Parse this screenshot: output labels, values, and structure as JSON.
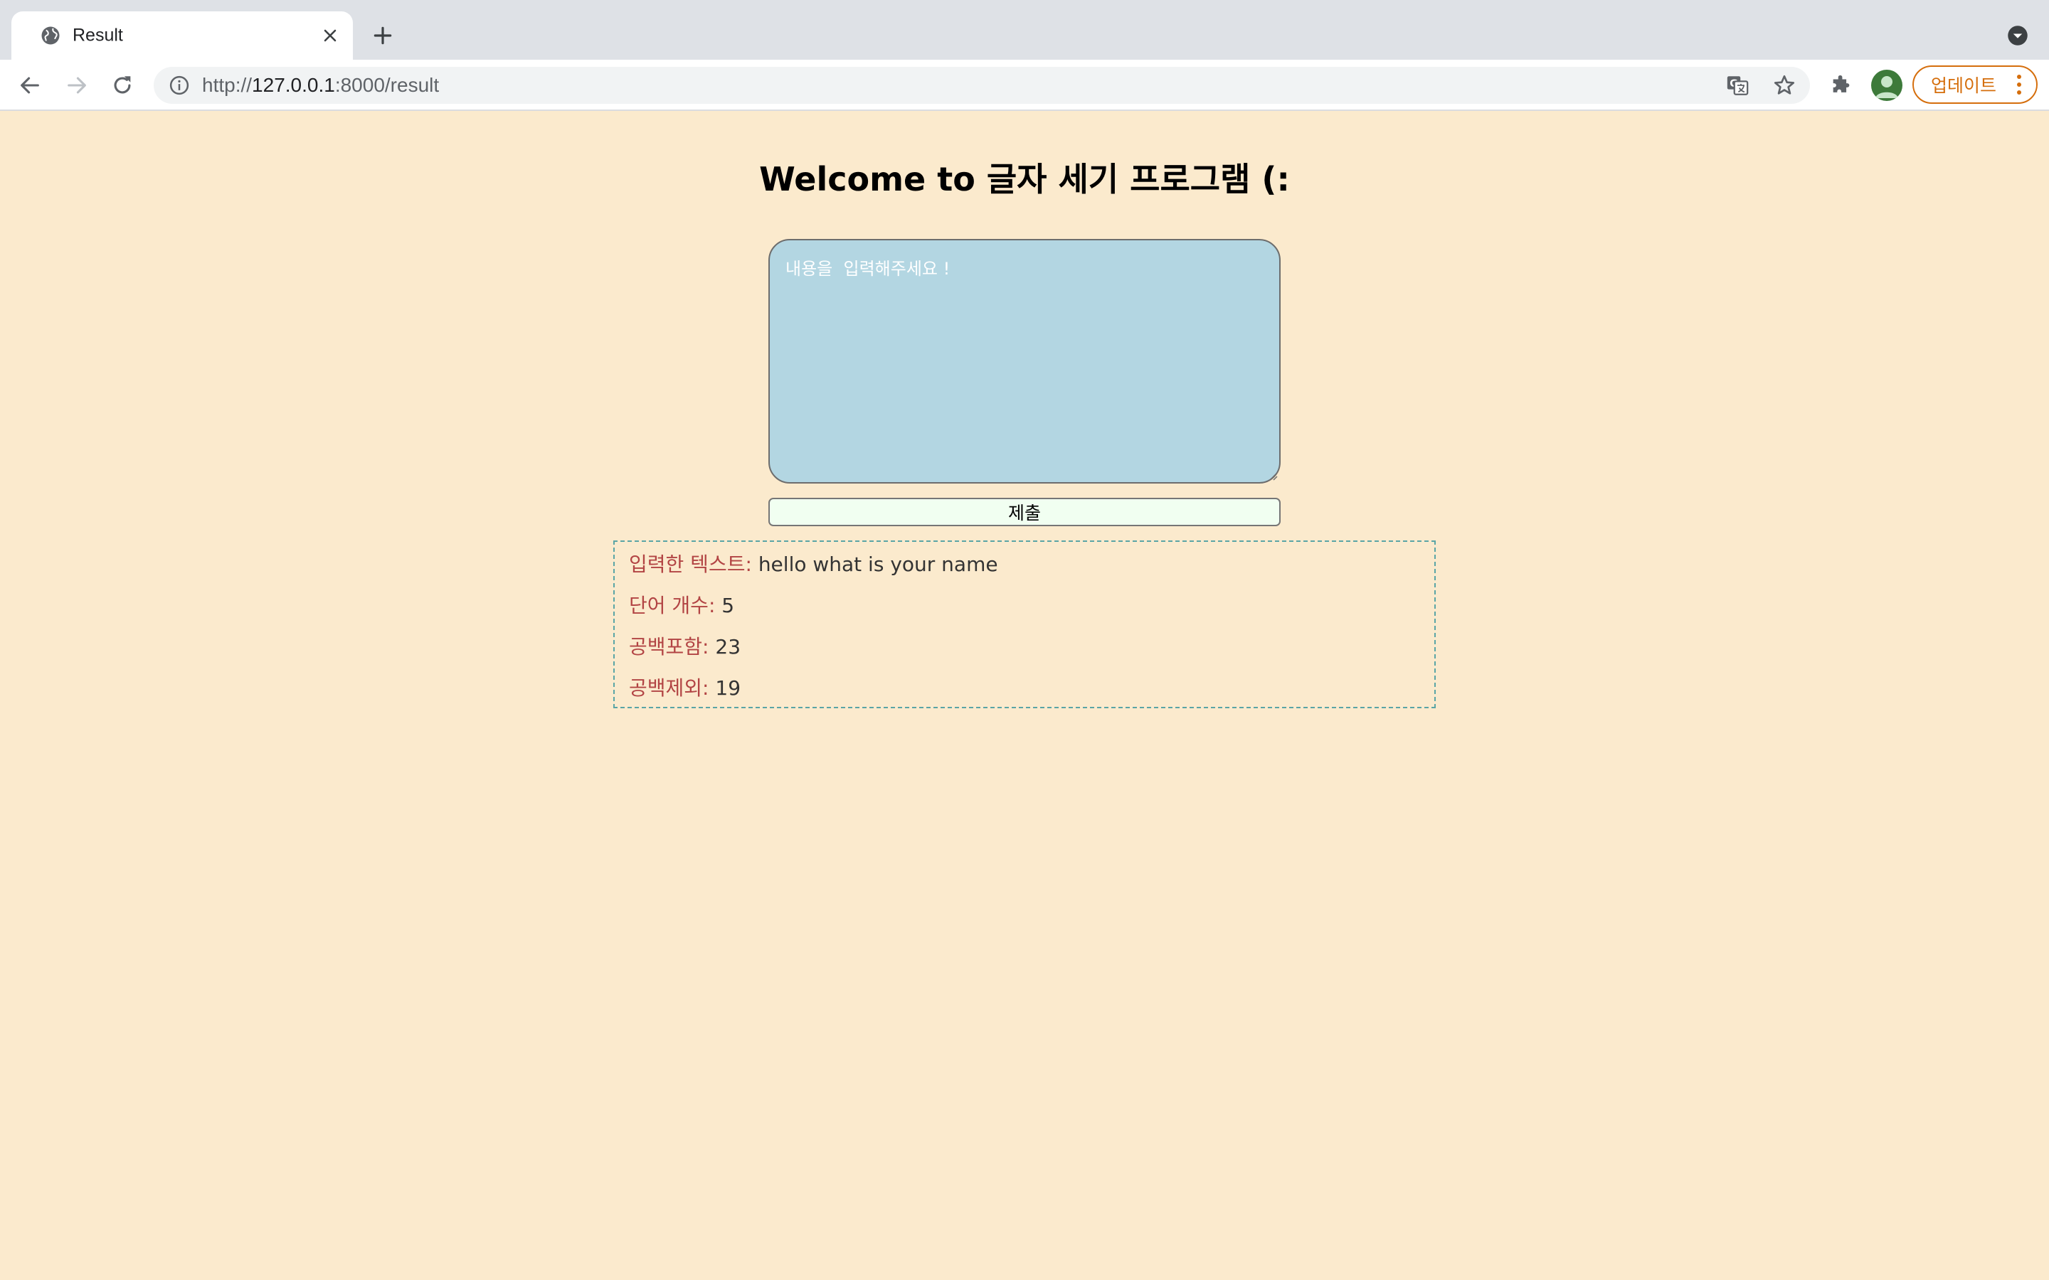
{
  "browser": {
    "tab_title": "Result",
    "url_scheme": "http://",
    "url_host": "127.0.0.1",
    "url_rest": ":8000/result",
    "update_label": "업데이트",
    "accent_color": "#d56e0c"
  },
  "page": {
    "title": "Welcome to 글자 세기 프로그램 (:",
    "background_color": "#fbeacd",
    "textarea": {
      "placeholder": "내용을  입력해주세요 !",
      "value": "",
      "background_color": "#b3d6e2"
    },
    "submit_label": "제출",
    "results": [
      {
        "label": "입력한 텍스트:",
        "value": "hello what is your name"
      },
      {
        "label": "단어 개수:",
        "value": "5"
      },
      {
        "label": "공백포함:",
        "value": "23"
      },
      {
        "label": "공백제외:",
        "value": "19"
      }
    ]
  },
  "icons": {
    "favicon": "globe-icon",
    "tab_close": "close-icon",
    "new_tab": "plus-icon",
    "tab_search": "chevron-down-circle-icon",
    "back": "back-arrow-icon",
    "forward": "forward-arrow-icon",
    "reload": "reload-icon",
    "site_info": "info-icon",
    "translate": "translate-icon",
    "bookmark": "star-icon",
    "extensions": "puzzle-icon",
    "profile": "avatar-icon",
    "menu": "kebab-menu-icon"
  }
}
